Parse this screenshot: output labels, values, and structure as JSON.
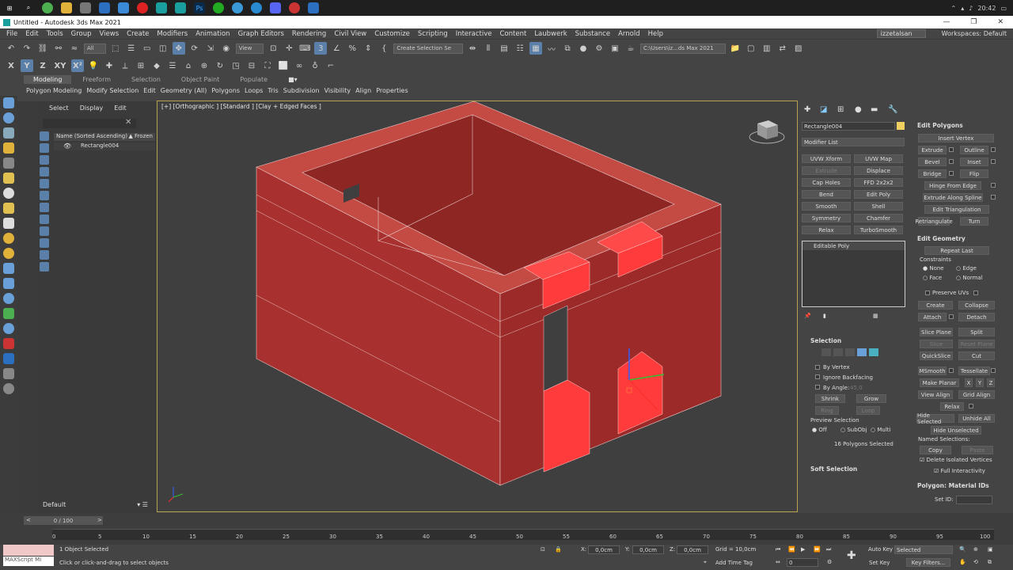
{
  "window": {
    "title": "Untitled - Autodesk 3ds Max 2021"
  },
  "taskbar": {
    "time": "20:42"
  },
  "menu": {
    "items": [
      "File",
      "Edit",
      "Tools",
      "Group",
      "Views",
      "Create",
      "Modifiers",
      "Animation",
      "Graph Editors",
      "Rendering",
      "Civil View",
      "Customize",
      "Scripting",
      "Interactive",
      "Content",
      "Laubwerk",
      "Substance",
      "Arnold",
      "Help"
    ],
    "user": "izzetalsan",
    "workspaces_label": "Workspaces:",
    "workspace": "Default"
  },
  "toolbar": {
    "filter": "All",
    "view": "View",
    "selection_set": "Create Selection Se",
    "path": "C:\\Users\\iz...ds Max 2021"
  },
  "ribbon": {
    "tabs": [
      "Modeling",
      "Freeform",
      "Selection",
      "Object Paint",
      "Populate"
    ],
    "subtabs": [
      "Polygon Modeling",
      "Modify Selection",
      "Edit",
      "Geometry (All)",
      "Polygons",
      "Loops",
      "Tris",
      "Subdivision",
      "Visibility",
      "Align",
      "Properties"
    ]
  },
  "scene_explorer": {
    "tabs": [
      "Select",
      "Display",
      "Edit"
    ],
    "col_name": "Name (Sorted Ascending)",
    "col_frozen": "▲ Frozen",
    "object": "Rectangle004",
    "layer": "Default"
  },
  "viewport": {
    "label": "[+] [Orthographic ] [Standard ] [Clay + Edged Faces ]"
  },
  "command_panel": {
    "object_name": "Rectangle004",
    "modifier_list": "Modifier List",
    "modifier_buttons": [
      "UVW Xform",
      "UVW Map",
      "Extrude",
      "Displace",
      "Cap Holes",
      "FFD 2x2x2",
      "Bend",
      "Edit Poly",
      "Smooth",
      "Shell",
      "Symmetry",
      "Chamfer",
      "Relax",
      "TurboSmooth"
    ],
    "stack_item": "Editable Poly",
    "selection": {
      "title": "Selection",
      "by_vertex": "By Vertex",
      "ignore_backfacing": "Ignore Backfacing",
      "by_angle": "By Angle:",
      "angle": "45,0",
      "shrink": "Shrink",
      "grow": "Grow",
      "ring": "Ring",
      "loop": "Loop",
      "preview": "Preview Selection",
      "off": "Off",
      "subobj": "SubObj",
      "multi": "Multi",
      "status": "16 Polygons Selected"
    },
    "soft_selection": "Soft Selection"
  },
  "edit_polygons": {
    "title": "Edit Polygons",
    "insert_vertex": "Insert Vertex",
    "extrude": "Extrude",
    "outline": "Outline",
    "bevel": "Bevel",
    "inset": "Inset",
    "bridge": "Bridge",
    "flip": "Flip",
    "hinge": "Hinge From Edge",
    "extrude_spline": "Extrude Along Spline",
    "edit_tri": "Edit Triangulation",
    "retriangulate": "Retriangulate",
    "turn": "Turn"
  },
  "edit_geometry": {
    "title": "Edit Geometry",
    "repeat_last": "Repeat Last",
    "constraints": "Constraints",
    "none": "None",
    "edge": "Edge",
    "face": "Face",
    "normal": "Normal",
    "preserve_uvs": "Preserve UVs",
    "create": "Create",
    "collapse": "Collapse",
    "attach": "Attach",
    "detach": "Detach",
    "slice_plane": "Slice Plane",
    "split": "Split",
    "slice": "Slice",
    "reset_plane": "Reset Plane",
    "quickslice": "QuickSlice",
    "cut": "Cut",
    "msmooth": "MSmooth",
    "tessellate": "Tessellate",
    "make_planar": "Make Planar",
    "x": "X",
    "y": "Y",
    "z": "Z",
    "view_align": "View Align",
    "grid_align": "Grid Align",
    "relax": "Relax",
    "hide_selected": "Hide Selected",
    "unhide_all": "Unhide All",
    "hide_unselected": "Hide Unselected",
    "named_sel": "Named Selections:",
    "copy": "Copy",
    "paste": "Paste",
    "delete_isolated": "Delete Isolated Vertices",
    "full_interactivity": "Full Interactivity"
  },
  "material_ids": {
    "title": "Polygon: Material IDs",
    "set_id": "Set ID:"
  },
  "timeline": {
    "frame": "0 / 100",
    "ticks": [
      "0",
      "5",
      "10",
      "15",
      "20",
      "25",
      "30",
      "35",
      "40",
      "45",
      "50",
      "55",
      "60",
      "65",
      "70",
      "75",
      "80",
      "85",
      "90",
      "95",
      "100"
    ]
  },
  "status": {
    "maxscript": "MAXScript Mi",
    "selected": "1 Object Selected",
    "prompt": "Click or click-and-drag to select objects",
    "x_label": "X:",
    "x": "0,0cm",
    "y_label": "Y:",
    "y": "0,0cm",
    "z_label": "Z:",
    "z": "0,0cm",
    "grid": "Grid = 10,0cm",
    "add_time_tag": "Add Time Tag",
    "auto_key": "Auto Key",
    "selected_dd": "Selected",
    "set_key": "Set Key",
    "key_filters": "Key Filters...",
    "frame_field": "0"
  },
  "colors": {
    "accent": "#5a7fa8",
    "model": "#a8302e",
    "selection": "#ff4a4a"
  }
}
